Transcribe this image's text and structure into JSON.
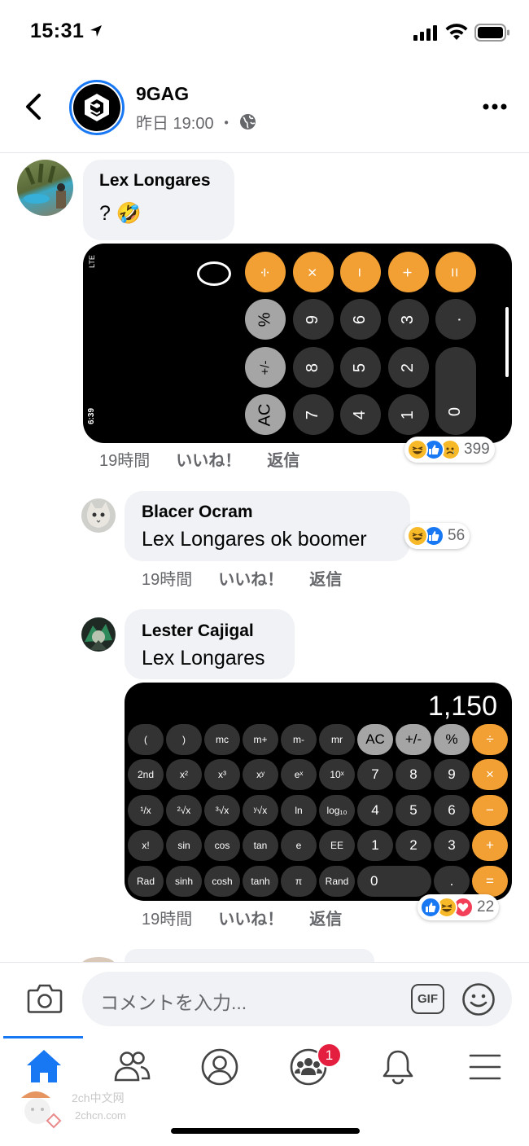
{
  "status": {
    "time": "15:31"
  },
  "post": {
    "page_name": "9GAG",
    "meta": "昨日 19:00 ・"
  },
  "comments": [
    {
      "name": "Lex Longares",
      "text": "? 🤣",
      "time": "19時間",
      "like": "いいね！",
      "reply": "返信",
      "reaction_count": "399",
      "calc_keys": {
        "row1": [
          "÷",
          "×",
          "−",
          "+",
          "="
        ],
        "row2": [
          "%",
          "9",
          "6",
          "3",
          "."
        ],
        "row3": [
          "+/-",
          "8",
          "5",
          "2",
          "0"
        ],
        "row4": [
          "AC",
          "7",
          "4",
          "1"
        ],
        "display": "0",
        "phone_status": "6:39",
        "phone_signal": "LTE"
      }
    },
    {
      "name": "Blacer Ocram",
      "text": "Lex Longares ok boomer",
      "time": "19時間",
      "like": "いいね！",
      "reply": "返信",
      "reaction_count": "56"
    },
    {
      "name": "Lester Cajigal",
      "text": "Lex Longares",
      "time": "19時間",
      "like": "いいね！",
      "reply": "返信",
      "reaction_count": "22",
      "calc": {
        "display": "1,150",
        "rows": [
          [
            "(",
            ")",
            "mc",
            "m+",
            "m-",
            "mr",
            "AC",
            "+/-",
            "%",
            "÷"
          ],
          [
            "2nd",
            "x²",
            "x³",
            "xʸ",
            "eˣ",
            "10ˣ",
            "7",
            "8",
            "9",
            "×"
          ],
          [
            "¹/x",
            "²√x",
            "³√x",
            "ʸ√x",
            "ln",
            "log₁₀",
            "4",
            "5",
            "6",
            "−"
          ],
          [
            "x!",
            "sin",
            "cos",
            "tan",
            "e",
            "EE",
            "1",
            "2",
            "3",
            "+"
          ],
          [
            "Rad",
            "sinh",
            "cosh",
            "tanh",
            "π",
            "Rand",
            "0",
            ".",
            "="
          ]
        ]
      }
    }
  ],
  "composer": {
    "placeholder": "コメントを入力...",
    "gif": "GIF"
  },
  "tabs": {
    "groups_badge": "1"
  },
  "watermark": {
    "line1": "2ch中文网",
    "line2": "2chcn.com"
  },
  "colors": {
    "accent": "#1877f2",
    "orange": "#f29f33",
    "badge": "#e41e3f"
  }
}
